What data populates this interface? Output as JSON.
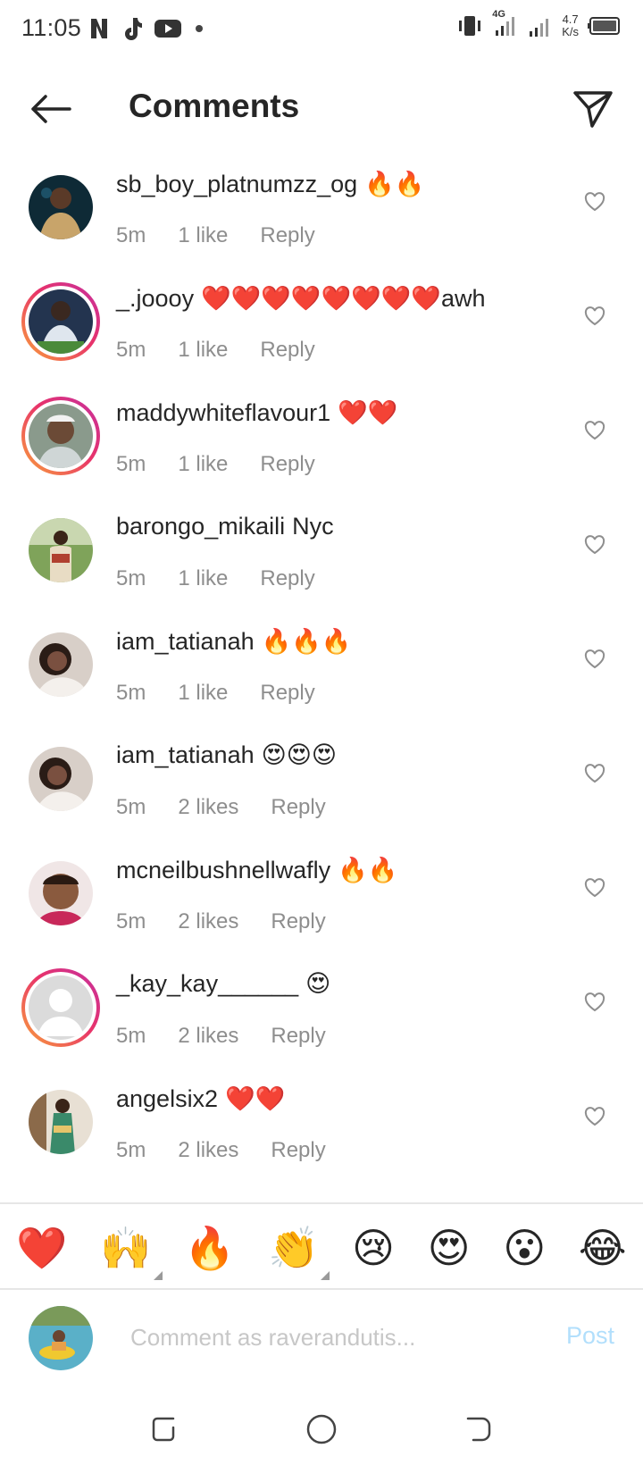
{
  "status_bar": {
    "time": "11:05",
    "network_label": "4G",
    "speed_value": "4.7",
    "speed_unit": "K/s",
    "left_icons": [
      "netflix-n-icon",
      "tiktok-icon",
      "youtube-icon",
      "dot-icon"
    ]
  },
  "header": {
    "title": "Comments"
  },
  "comments": [
    {
      "username": "sb_boy_platnumzz_og",
      "text": "🔥🔥",
      "time": "5m",
      "likes": "1 like",
      "reply": "Reply"
    },
    {
      "username": "_.joooy",
      "text": "❤️❤️❤️❤️❤️❤️❤️❤️awh",
      "time": "5m",
      "likes": "1 like",
      "reply": "Reply"
    },
    {
      "username": "maddywhiteflavour1",
      "text": "❤️❤️",
      "time": "5m",
      "likes": "1 like",
      "reply": "Reply"
    },
    {
      "username": "barongo_mikaili",
      "text": "Nyc",
      "time": "5m",
      "likes": "1 like",
      "reply": "Reply"
    },
    {
      "username": "iam_tatianah",
      "text": "🔥🔥🔥",
      "time": "5m",
      "likes": "1 like",
      "reply": "Reply"
    },
    {
      "username": "iam_tatianah",
      "text": "😍😍😍",
      "time": "5m",
      "likes": "2 likes",
      "reply": "Reply"
    },
    {
      "username": "mcneilbushnellwafly",
      "text": "🔥🔥",
      "time": "5m",
      "likes": "2 likes",
      "reply": "Reply"
    },
    {
      "username": "_kay_kay______",
      "text": "😍",
      "time": "5m",
      "likes": "2 likes",
      "reply": "Reply"
    },
    {
      "username": "angelsix2",
      "text": "❤️❤️",
      "time": "5m",
      "likes": "2 likes",
      "reply": "Reply"
    }
  ],
  "reactions": [
    "❤️",
    "🙌",
    "🔥",
    "👏",
    "😢",
    "😍",
    "😮",
    "😂"
  ],
  "composer": {
    "placeholder": "Comment as raverandutis...",
    "post_label": "Post"
  },
  "colors": {
    "text": "#262626",
    "meta": "#8e8e8e",
    "post_disabled": "#b2dffc",
    "story_ring_start": "#f9a23a",
    "story_ring_end": "#c530a0"
  }
}
